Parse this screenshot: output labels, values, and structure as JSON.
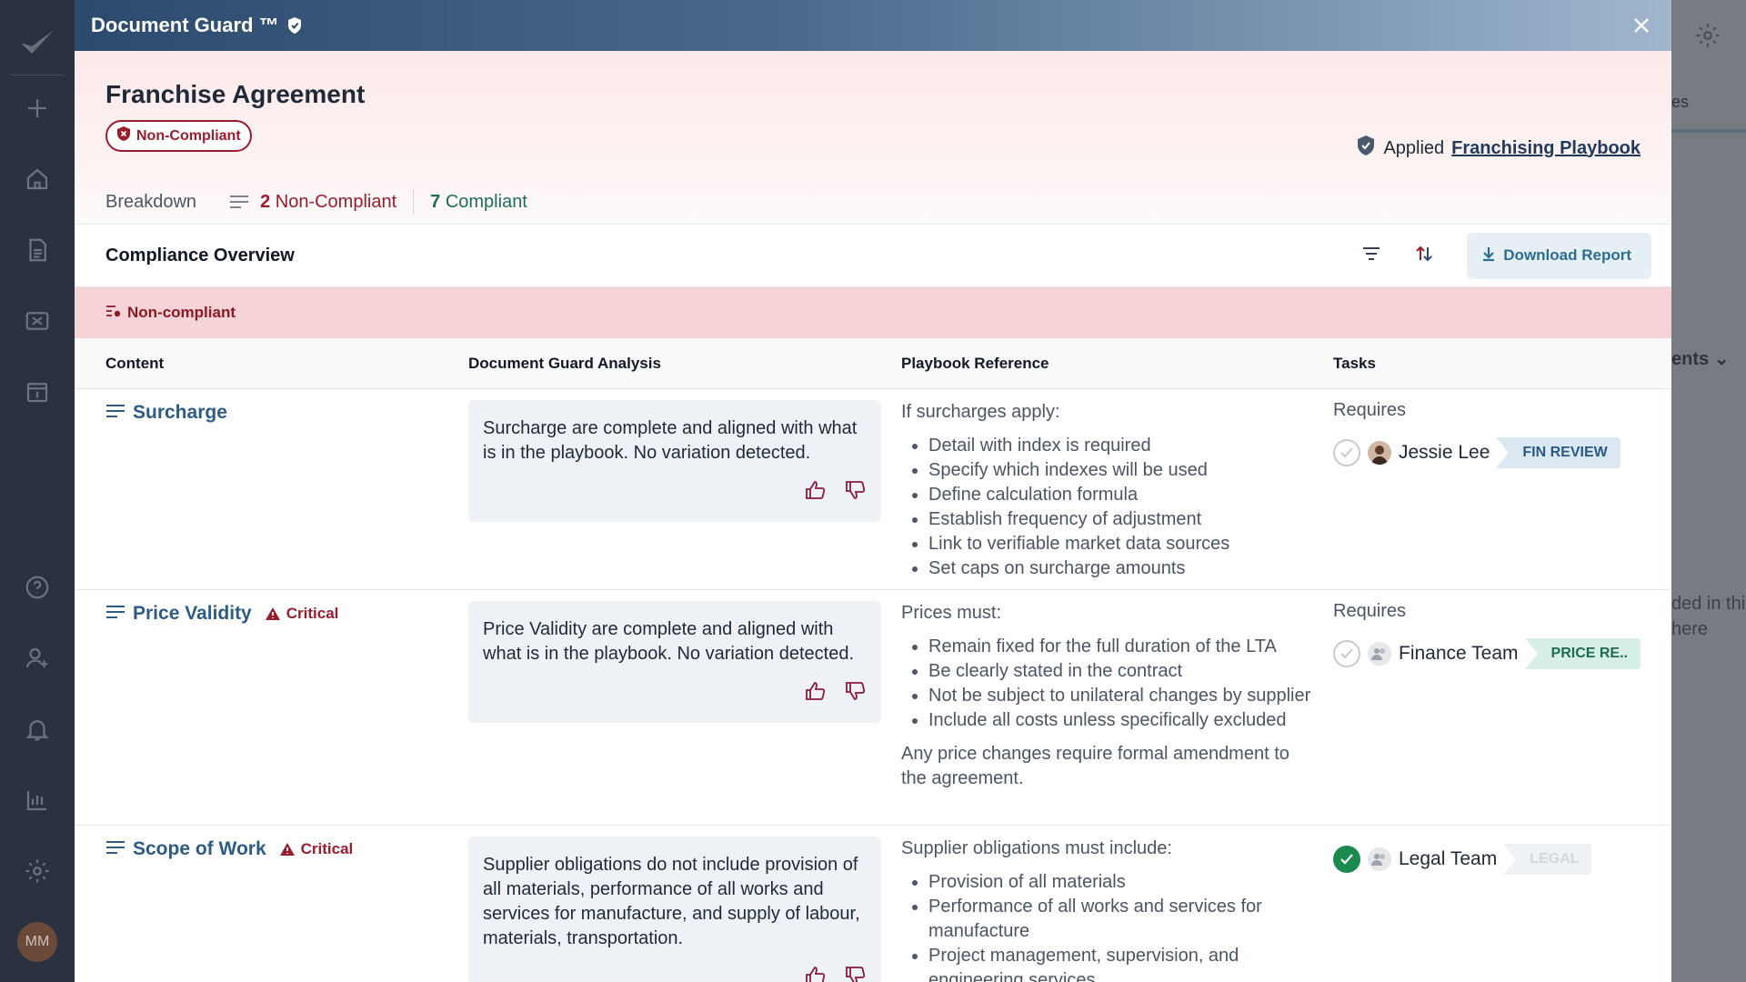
{
  "app_sidebar": {
    "avatar_initials": "MM",
    "items": [
      "add-icon",
      "home-icon",
      "documents-icon",
      "review-icon",
      "calendar-icon",
      "help-icon",
      "add-user-icon",
      "bell-icon",
      "analytics-icon",
      "settings-icon"
    ]
  },
  "background": {
    "tab_fragment": "es",
    "dropdown_fragment": "ents",
    "text_line1": "ded in thi",
    "text_line2": "here"
  },
  "modal": {
    "title": "Document Guard ™",
    "document_title": "Franchise Agreement",
    "status": "Non-Compliant",
    "applied_prefix": "Applied",
    "playbook_link": "Franchising Playbook",
    "breakdown": {
      "label": "Breakdown",
      "noncompliant_count": "2",
      "noncompliant_label": "Non-Compliant",
      "compliant_count": "7",
      "compliant_label": "Compliant"
    },
    "overview": {
      "title": "Compliance Overview",
      "download_label": "Download Report"
    },
    "section_label": "Non-compliant",
    "columns": {
      "content": "Content",
      "analysis": "Document Guard Analysis",
      "playbook": "Playbook Reference",
      "tasks": "Tasks"
    },
    "rows": [
      {
        "clause": "Surcharge",
        "critical": "",
        "analysis": "Surcharge are complete and aligned with what is in the playbook. No variation detected.",
        "playbook_intro": "If surcharges apply:",
        "playbook_items": [
          "Detail with index is required",
          "Specify which indexes will be used",
          "Define calculation formula",
          "Establish frequency of adjustment",
          "Link to verifiable market data sources",
          "Set caps on surcharge amounts"
        ],
        "playbook_after": "",
        "tasks_label": "Requires",
        "assignee": "Jessie Lee",
        "tag": "FIN REVIEW",
        "done": false
      },
      {
        "clause": "Price Validity",
        "critical": "Critical",
        "analysis": "Price Validity are complete and aligned with what is in the playbook. No variation detected.",
        "playbook_intro": "Prices must:",
        "playbook_items": [
          "Remain fixed for the full duration of the LTA",
          "Be clearly stated in the contract",
          "Not be subject to unilateral changes by supplier",
          "Include all costs unless specifically excluded"
        ],
        "playbook_after": "Any price changes require formal amendment to the agreement.",
        "tasks_label": "Requires",
        "assignee": "Finance Team",
        "tag": "PRICE RE..",
        "done": false
      },
      {
        "clause": "Scope of Work",
        "critical": "Critical",
        "analysis": "Supplier obligations do not include provision of all materials, performance of all works and services for manufacture, and supply of labour, materials, transportation.",
        "playbook_intro": "Supplier obligations must include:",
        "playbook_items": [
          "Provision of all materials",
          "Performance of all works and services for manufacture",
          "Project management, supervision, and engineering services"
        ],
        "playbook_after": "",
        "tasks_label": "",
        "assignee": "Legal Team",
        "tag": "LEGAL",
        "done": true
      }
    ]
  },
  "colors": {
    "accent_red": "#9b1c2c",
    "accent_blue": "#2c5b86",
    "accent_green": "#1e6b61",
    "band_pink": "#f6d3d6"
  }
}
